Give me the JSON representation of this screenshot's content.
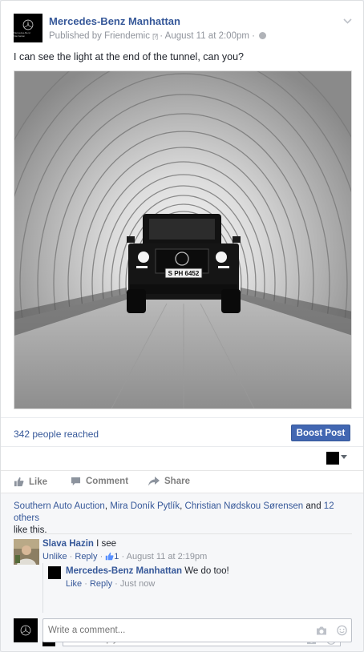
{
  "post": {
    "page_name": "Mercedes-Benz Manhattan",
    "published_by_prefix": "Published by",
    "publisher": "Friendemic",
    "publisher_tag": "[?]",
    "date_sep": "·",
    "date": "August 11 at 2:00pm",
    "text": "I can see the light at the end of the tunnel, can you?",
    "avatar_mini_text": "Mercedes-Benz Manhattan",
    "plate": "S PH 6452"
  },
  "insights": {
    "reach": "342 people reached",
    "boost_label": "Boost Post"
  },
  "actions": {
    "like": "Like",
    "comment": "Comment",
    "share": "Share"
  },
  "likes": {
    "name1": "Southern Auto Auction",
    "sep1": ",",
    "name2": "Mira Doník Pytlík",
    "sep2": ",",
    "name3": "Christian Nødskou Sørensen",
    "and": "and",
    "others": "12 others",
    "suffix": "like this."
  },
  "comments": [
    {
      "author": "Slava Hazin",
      "text": "I see",
      "unlike": "Unlike",
      "reply": "Reply",
      "like_count": "1",
      "time": "August 11 at 2:19pm",
      "replies": [
        {
          "author": "Mercedes-Benz Manhattan",
          "text": "We do too!",
          "like": "Like",
          "reply": "Reply",
          "time": "Just now"
        }
      ]
    }
  ],
  "reply_box": {
    "placeholder": "Write a reply..."
  },
  "comment_box": {
    "placeholder": "Write a comment..."
  },
  "colors": {
    "link": "#365899",
    "boost": "#4267b2",
    "meta": "#90949c"
  }
}
